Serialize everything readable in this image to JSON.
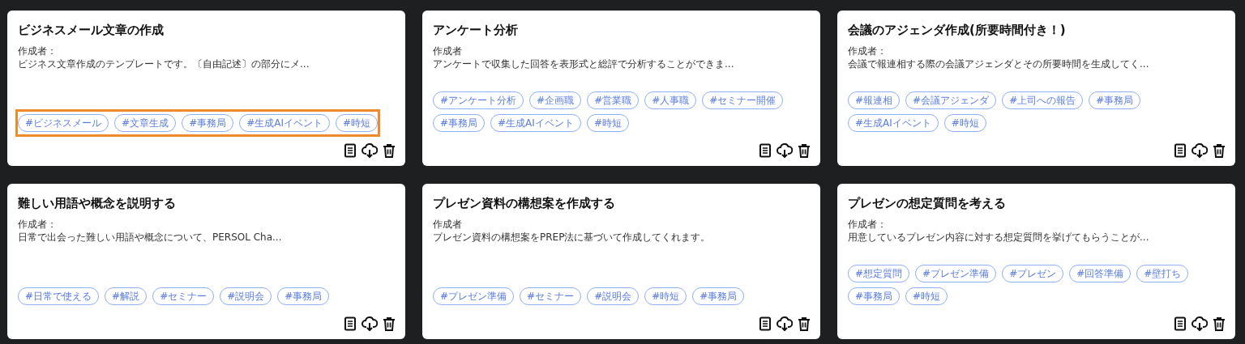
{
  "cards": [
    {
      "title": "ビジネスメール文章の作成",
      "author": "作成者：",
      "description": "ビジネス文章作成のテンプレートです。〔自由記述〕の部分にメ...",
      "highlighted": true,
      "tags": [
        "#ビジネスメール",
        "#文章生成",
        "#事務局",
        "#生成AIイベント",
        "#時短"
      ]
    },
    {
      "title": "アンケート分析",
      "author": "作成者",
      "description": "アンケートで収集した回答を表形式と総評で分析することができま...",
      "highlighted": false,
      "tags": [
        "#アンケート分析",
        "#企画職",
        "#営業職",
        "#人事職",
        "#セミナー開催",
        "#事務局",
        "#生成AIイベント",
        "#時短"
      ]
    },
    {
      "title": "会議のアジェンダ作成(所要時間付き！)",
      "author": "作成者：",
      "description": "会議で報連相する際の会議アジェンダとその所要時間を生成してく...",
      "highlighted": false,
      "tags": [
        "#報連相",
        "#会議アジェンダ",
        "#上司への報告",
        "#事務局",
        "#生成AIイベント",
        "#時短"
      ]
    },
    {
      "title": "難しい用語や概念を説明する",
      "author": "作成者：",
      "description": "日常で出会った難しい用語や概念について、PERSOL Cha...",
      "highlighted": false,
      "tags": [
        "#日常で使える",
        "#解説",
        "#セミナー",
        "#説明会",
        "#事務局"
      ]
    },
    {
      "title": "プレゼン資料の構想案を作成する",
      "author": "作成者",
      "description": "プレゼン資料の構想案をPREP法に基づいて作成してくれます。",
      "highlighted": false,
      "tags": [
        "#プレゼン準備",
        "#セミナー",
        "#説明会",
        "#時短",
        "#事務局"
      ]
    },
    {
      "title": "プレゼンの想定質問を考える",
      "author": "作成者：",
      "description": "用意しているプレゼン内容に対する想定質問を挙げてもらうことが...",
      "highlighted": false,
      "tags": [
        "#想定質問",
        "#プレゼン準備",
        "#プレゼン",
        "#回答準備",
        "#壁打ち",
        "#事務局",
        "#時短"
      ]
    }
  ]
}
